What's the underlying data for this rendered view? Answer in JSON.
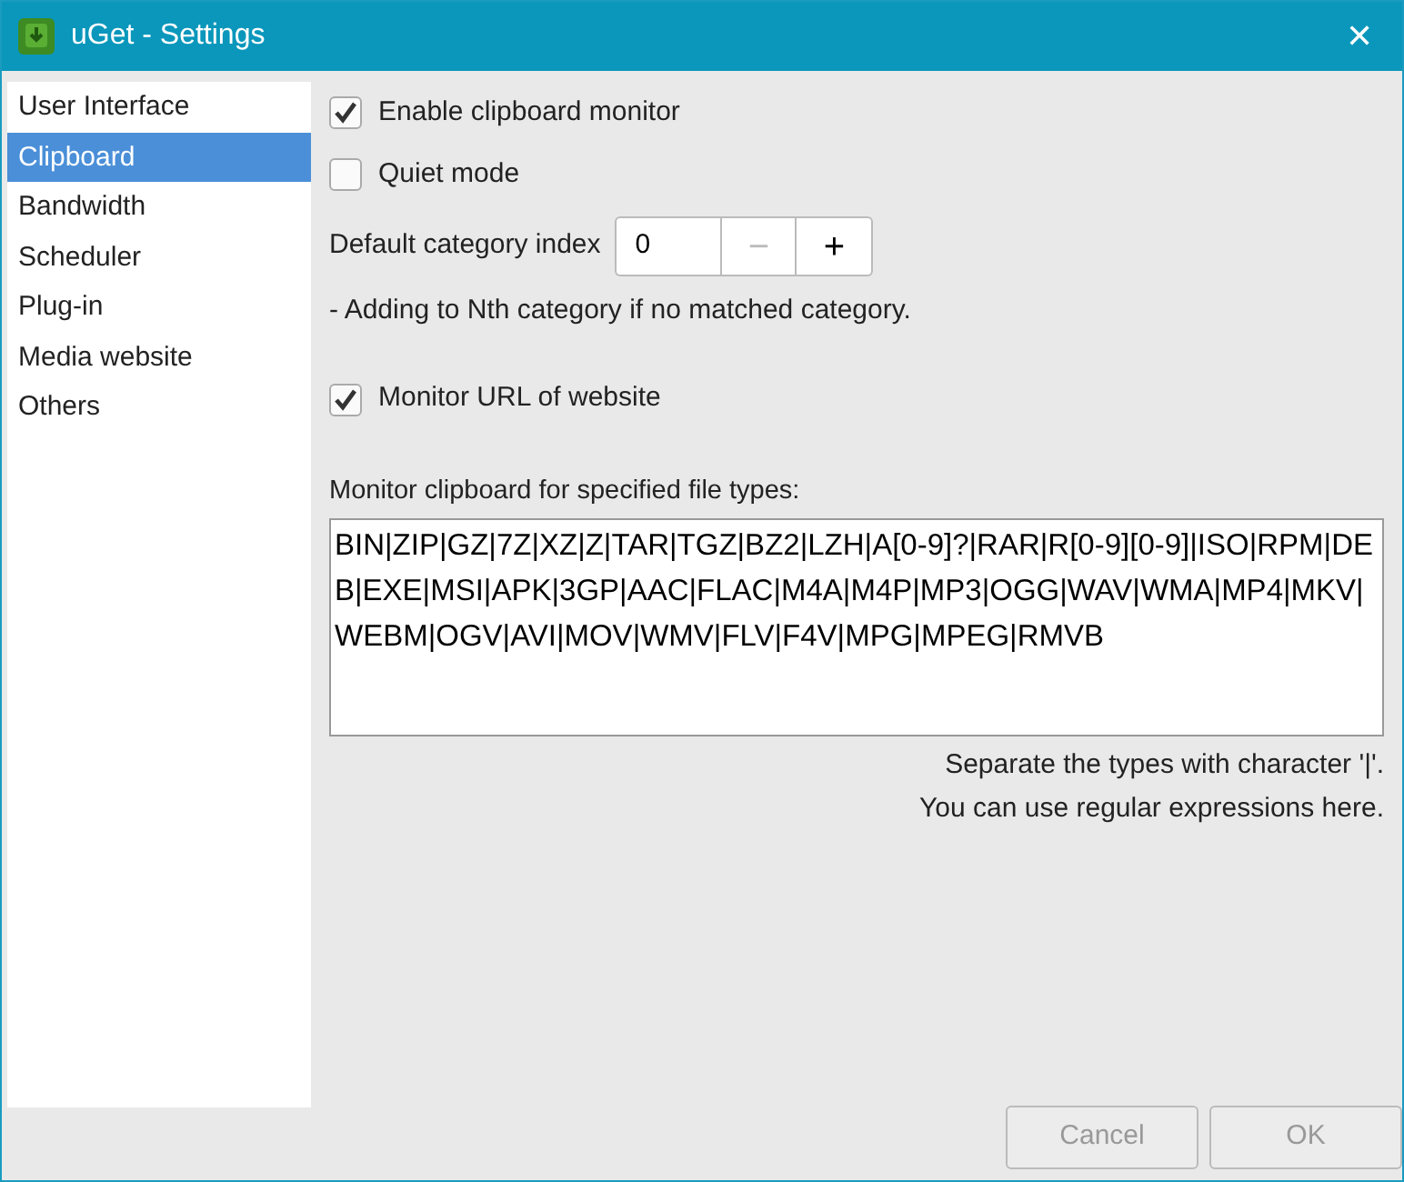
{
  "window": {
    "title": "uGet - Settings",
    "close": "✕"
  },
  "sidebar": {
    "items": [
      {
        "label": "User Interface",
        "selected": false
      },
      {
        "label": "Clipboard",
        "selected": true
      },
      {
        "label": "Bandwidth",
        "selected": false
      },
      {
        "label": "Scheduler",
        "selected": false
      },
      {
        "label": "Plug-in",
        "selected": false
      },
      {
        "label": "Media website",
        "selected": false
      },
      {
        "label": "Others",
        "selected": false
      }
    ]
  },
  "enable_monitor": {
    "label": "Enable clipboard monitor",
    "checked": true
  },
  "quiet_mode": {
    "label": "Quiet mode",
    "checked": false
  },
  "category_index": {
    "label": "Default category index",
    "value": "0",
    "minus": "−",
    "plus": "+",
    "minus_disabled": true
  },
  "category_hint": "-  Adding to Nth category if no matched category.",
  "monitor_url": {
    "label": "Monitor URL of website",
    "checked": true
  },
  "file_types": {
    "label": "Monitor clipboard for specified file types:",
    "value": "BIN|ZIP|GZ|7Z|XZ|Z|TAR|TGZ|BZ2|LZH|A[0-9]?|RAR|R[0-9][0-9]|ISO|RPM|DEB|EXE|MSI|APK|3GP|AAC|FLAC|M4A|M4P|MP3|OGG|WAV|WMA|MP4|MKV|WEBM|OGV|AVI|MOV|WMV|FLV|F4V|MPG|MPEG|RMVB"
  },
  "notes": [
    "Separate the types with character '|'.",
    "You can use regular expressions here."
  ],
  "buttons": [
    {
      "label": "Cancel",
      "disabled": true
    },
    {
      "label": "OK",
      "disabled": true
    }
  ]
}
